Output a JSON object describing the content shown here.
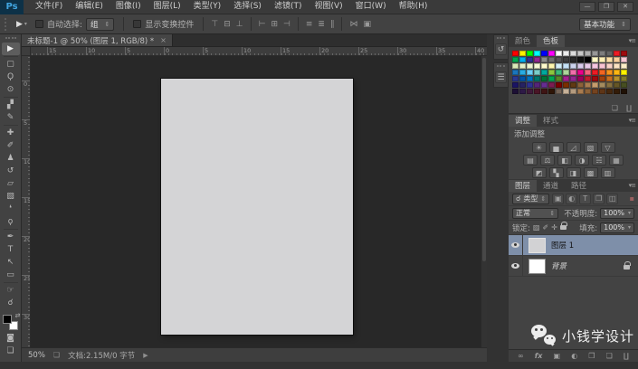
{
  "ui": {
    "dd_arrow": "⇕",
    "small_arrow": "▾",
    "pin_icon": "▪",
    "search_icon": "☌",
    "swap_icon": "⇄"
  },
  "menu_bar": {
    "logo": "Ps",
    "items": [
      {
        "label": "文件(F)",
        "name": "file"
      },
      {
        "label": "编辑(E)",
        "name": "edit"
      },
      {
        "label": "图像(I)",
        "name": "image"
      },
      {
        "label": "图层(L)",
        "name": "layer"
      },
      {
        "label": "类型(Y)",
        "name": "type"
      },
      {
        "label": "选择(S)",
        "name": "select"
      },
      {
        "label": "滤镜(T)",
        "name": "filter"
      },
      {
        "label": "视图(V)",
        "name": "view"
      },
      {
        "label": "窗口(W)",
        "name": "window"
      },
      {
        "label": "帮助(H)",
        "name": "help"
      }
    ],
    "window_controls": [
      "—",
      "❐",
      "✕"
    ]
  },
  "options_bar": {
    "tool_glyph": "▶",
    "auto_select_label": "自动选择:",
    "auto_select_value": "组",
    "show_transform_label": "显示变换控件",
    "align_groups": [
      [
        {
          "name": "align-top-edges",
          "glyph": "⊤"
        },
        {
          "name": "align-vertical-centers",
          "glyph": "⊟"
        },
        {
          "name": "align-bottom-edges",
          "glyph": "⊥"
        }
      ],
      [
        {
          "name": "align-left-edges",
          "glyph": "⊢"
        },
        {
          "name": "align-horizontal-centers",
          "glyph": "⊞"
        },
        {
          "name": "align-right-edges",
          "glyph": "⊣"
        }
      ],
      [
        {
          "name": "distribute-top-edges",
          "glyph": "≡"
        },
        {
          "name": "distribute-vertical-centers",
          "glyph": "≣"
        },
        {
          "name": "distribute-bottom-edges",
          "glyph": "∥"
        }
      ],
      [
        {
          "name": "distribute-horizontal-centers",
          "glyph": "⋈"
        },
        {
          "name": "auto-align-layers",
          "glyph": "▣"
        }
      ]
    ],
    "workspace": "基本功能"
  },
  "document_tab": {
    "title": "未标题-1 @ 50% (图层 1, RGB/8) *",
    "close": "×"
  },
  "rulers": {
    "h_labels": [
      "15",
      "10",
      "5",
      "0",
      "5",
      "10",
      "15",
      "20",
      "25",
      "30",
      "35",
      "40"
    ],
    "v_labels": [
      "0",
      "5",
      "10",
      "15",
      "20",
      "25",
      "30"
    ]
  },
  "toolbar": {
    "tools": [
      {
        "name": "move-tool",
        "glyph": "▶",
        "selected": true,
        "sep_after": true
      },
      {
        "name": "rectangular-marquee-tool",
        "glyph": "▢"
      },
      {
        "name": "lasso-tool",
        "glyph": "Ϙ"
      },
      {
        "name": "quick-selection-tool",
        "glyph": "⊙",
        "sep_after": true
      },
      {
        "name": "crop-tool",
        "glyph": "▞"
      },
      {
        "name": "eyedropper-tool",
        "glyph": "✎",
        "sep_after": true
      },
      {
        "name": "spot-healing-brush-tool",
        "glyph": "✚"
      },
      {
        "name": "brush-tool",
        "glyph": "✐"
      },
      {
        "name": "clone-stamp-tool",
        "glyph": "♟"
      },
      {
        "name": "history-brush-tool",
        "glyph": "↺"
      },
      {
        "name": "eraser-tool",
        "glyph": "▱"
      },
      {
        "name": "gradient-tool",
        "glyph": "▧"
      },
      {
        "name": "blur-tool",
        "glyph": "❛"
      },
      {
        "name": "dodge-tool",
        "glyph": "ϙ",
        "sep_after": true
      },
      {
        "name": "pen-tool",
        "glyph": "✒"
      },
      {
        "name": "horizontal-type-tool",
        "glyph": "T"
      },
      {
        "name": "path-selection-tool",
        "glyph": "↖"
      },
      {
        "name": "rectangle-tool",
        "glyph": "▭",
        "sep_after": true
      },
      {
        "name": "hand-tool",
        "glyph": "☞"
      },
      {
        "name": "zoom-tool",
        "glyph": "☌"
      }
    ],
    "foreground": "#000000",
    "background": "#ffffff",
    "quick_mask_glyph": "◙",
    "screen_mode_glyph": "❏"
  },
  "canvas": {
    "color": "#d4d4d6"
  },
  "dock_narrow": {
    "panels": [
      {
        "name": "history-panel",
        "glyph": "↺"
      },
      {
        "name": "properties-panel",
        "glyph": "☰"
      }
    ]
  },
  "panels": {
    "swatches": {
      "tabs": [
        {
          "label": "颜色",
          "active": false
        },
        {
          "label": "色板",
          "active": true
        }
      ],
      "menu_icon": "▾≡",
      "colors": [
        [
          "#ff0000",
          "#fff200",
          "#00ff00",
          "#00ffff",
          "#0000ff",
          "#ff00ff",
          "#ffffff",
          "#ededed",
          "#dbdbdb",
          "#c8c8c8",
          "#b0b0b0",
          "#979797",
          "#7d7d7d",
          "#636363",
          "#ed1c24",
          "#9e0b0f"
        ],
        [
          "#00a651",
          "#00aeef",
          "#2e3192",
          "#92278f",
          "#8a8a8a",
          "#6f6f6f",
          "#555555",
          "#3d3d3d",
          "#282828",
          "#121212",
          "#000000",
          "#fff9c6",
          "#fdeeb5",
          "#fbdfa6",
          "#f9cf9d",
          "#f6c6d2"
        ],
        [
          "#d9e8b8",
          "#e4f0c8",
          "#eef5d2",
          "#f7f9d7",
          "#fdfacc",
          "#fdf6ae",
          "#d2eef8",
          "#c4e1f6",
          "#ccd3ee",
          "#d9cbeb",
          "#e9cbe9",
          "#f5c5df",
          "#f8c3d2",
          "#fad2c6",
          "#fce3c2",
          "#fdeec8"
        ],
        [
          "#1b75bb",
          "#29abe1",
          "#6dcff6",
          "#7accc8",
          "#00a99d",
          "#8dc63f",
          "#3cb878",
          "#acd59a",
          "#f06eaa",
          "#ec008c",
          "#f2637d",
          "#ed1c24",
          "#f26522",
          "#f7941d",
          "#fcb614",
          "#fff200"
        ],
        [
          "#2b3990",
          "#0054a6",
          "#0072bc",
          "#00746b",
          "#007236",
          "#00a651",
          "#598527",
          "#a3238e",
          "#92278f",
          "#9e005d",
          "#be1e2d",
          "#9e0b0f",
          "#a0410d",
          "#c96f1f",
          "#b8912c",
          "#7f7a2c"
        ],
        [
          "#1b1464",
          "#262262",
          "#2e3192",
          "#54247a",
          "#662d91",
          "#7b1d52",
          "#790000",
          "#7b2e00",
          "#603913",
          "#8c6239",
          "#a97c50",
          "#c69c6d",
          "#a48b5e",
          "#867040",
          "#655626",
          "#474f21"
        ],
        [
          "#1d1035",
          "#2e1a47",
          "#3f1b3a",
          "#4a1526",
          "#3f1515",
          "#2e1507",
          "#736357",
          "#c7b299",
          "#b49b7f",
          "#a97c50",
          "#8c6239",
          "#75431f",
          "#5e3517",
          "#46280f",
          "#331c08",
          "#1f1105"
        ]
      ],
      "new_icon": "❏",
      "trash_icon": "∐"
    },
    "adjustments": {
      "tabs": [
        {
          "label": "调整",
          "active": true
        },
        {
          "label": "样式",
          "active": false
        }
      ],
      "hint": "添加调整",
      "rows": [
        [
          {
            "name": "brightness-contrast",
            "glyph": "☀"
          },
          {
            "name": "levels",
            "glyph": "▅"
          },
          {
            "name": "curves",
            "glyph": "◿"
          },
          {
            "name": "exposure",
            "glyph": "▧"
          },
          {
            "name": "vibrance",
            "glyph": "▽"
          }
        ],
        [
          {
            "name": "hue-saturation",
            "glyph": "▤"
          },
          {
            "name": "color-balance",
            "glyph": "⚖"
          },
          {
            "name": "black-white",
            "glyph": "◧"
          },
          {
            "name": "photo-filter",
            "glyph": "◑"
          },
          {
            "name": "channel-mixer",
            "glyph": "☵"
          },
          {
            "name": "color-lookup",
            "glyph": "▦"
          }
        ],
        [
          {
            "name": "invert",
            "glyph": "◩"
          },
          {
            "name": "posterize",
            "glyph": "▚"
          },
          {
            "name": "threshold",
            "glyph": "◨"
          },
          {
            "name": "gradient-map",
            "glyph": "▩"
          },
          {
            "name": "selective-color",
            "glyph": "▥"
          }
        ]
      ]
    },
    "layers": {
      "tabs": [
        {
          "label": "图层",
          "active": true
        },
        {
          "label": "通道",
          "active": false
        },
        {
          "label": "路径",
          "active": false
        }
      ],
      "filter": {
        "label": "类型",
        "icons": [
          {
            "name": "filter-pixel-layers",
            "glyph": "▣"
          },
          {
            "name": "filter-adjustment-layers",
            "glyph": "◐"
          },
          {
            "name": "filter-type-layers",
            "glyph": "T"
          },
          {
            "name": "filter-shape-layers",
            "glyph": "❒"
          },
          {
            "name": "filter-smart-objects",
            "glyph": "◫"
          }
        ]
      },
      "blend_mode": "正常",
      "opacity_label": "不透明度:",
      "opacity_value": "100%",
      "lock_label": "锁定:",
      "lock_icons": [
        {
          "name": "lock-transparent-pixels",
          "glyph": "▨"
        },
        {
          "name": "lock-image-pixels",
          "glyph": "✐"
        },
        {
          "name": "lock-position",
          "glyph": "✛"
        }
      ],
      "fill_label": "填充:",
      "fill_value": "100%",
      "layers": [
        {
          "name": "图层 1",
          "thumb": "#d2d2d4",
          "selected": true,
          "italic": false,
          "locked": false,
          "visible": true
        },
        {
          "name": "背景",
          "thumb": "#ffffff",
          "selected": false,
          "italic": true,
          "locked": true,
          "visible": true
        }
      ],
      "bottom_icons": [
        {
          "name": "link-layers",
          "glyph": "∞"
        },
        {
          "name": "layer-style-fx",
          "glyph": "fx"
        },
        {
          "name": "add-layer-mask",
          "glyph": "▣"
        },
        {
          "name": "new-adjustment-layer",
          "glyph": "◐"
        },
        {
          "name": "new-group",
          "glyph": "❒"
        },
        {
          "name": "new-layer",
          "glyph": "❏"
        },
        {
          "name": "delete-layer",
          "glyph": "∐"
        }
      ]
    }
  },
  "status_bar": {
    "zoom": "50%",
    "doc_icon": "❏",
    "doc_info": "文档:2.15M/0 字节",
    "arrow": "▶"
  },
  "watermark": {
    "text": "小钱学设计"
  }
}
